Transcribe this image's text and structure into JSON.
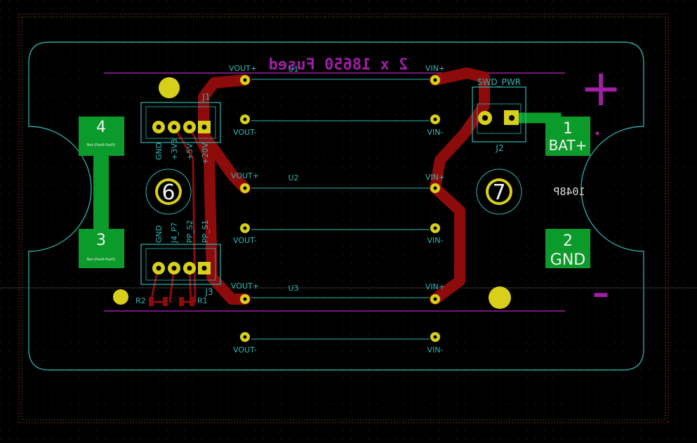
{
  "title_text": "2 x 18650 Fused",
  "board_id": "1048P",
  "colors": {
    "background": "#000000",
    "outline": "#2aa6a0",
    "silk": "#2fb7b3",
    "copper": "#8e0b0b",
    "fab_pad": "#0b9b2a",
    "pad_gold": "#d8cf1a",
    "magenta": "#a01ea5",
    "mark": "#e8e8e8"
  },
  "regulators": [
    {
      "ref": "U1",
      "vout_plus": "VOUT+",
      "vout_minus": "VOUT-",
      "vin_plus": "VIN+",
      "vin_minus": "VIN-"
    },
    {
      "ref": "U2",
      "vout_plus": "VOUT+",
      "vout_minus": "VOUT-",
      "vin_plus": "VIN+",
      "vin_minus": "VIN-"
    },
    {
      "ref": "U3",
      "vout_plus": "VOUT+",
      "vout_minus": "VOUT-",
      "vin_plus": "VIN+",
      "vin_minus": "VIN-"
    }
  ],
  "connectors": {
    "j1": {
      "ref": "J1",
      "pins": [
        "GND",
        "+3V3",
        "+5V",
        "+20V"
      ]
    },
    "j3": {
      "ref": "J3",
      "pins": [
        "GND",
        "J4_P7",
        "PP_S2",
        "PP_S1"
      ]
    },
    "j2": {
      "ref": "J2",
      "label": "SWD_PWR"
    }
  },
  "resistors": [
    "R2",
    "R1"
  ],
  "mounting_holes": [
    "6",
    "7"
  ],
  "pads": {
    "p4": {
      "num": "4",
      "net": "Net-(Pad4-Pad3)"
    },
    "p3": {
      "num": "3",
      "net": "Net-(Pad4-Pad3)"
    },
    "p1": {
      "num": "1",
      "net": "BAT+"
    },
    "p2": {
      "num": "2",
      "net": "GND"
    }
  },
  "polarity": {
    "plus": "+",
    "minus": "-"
  }
}
